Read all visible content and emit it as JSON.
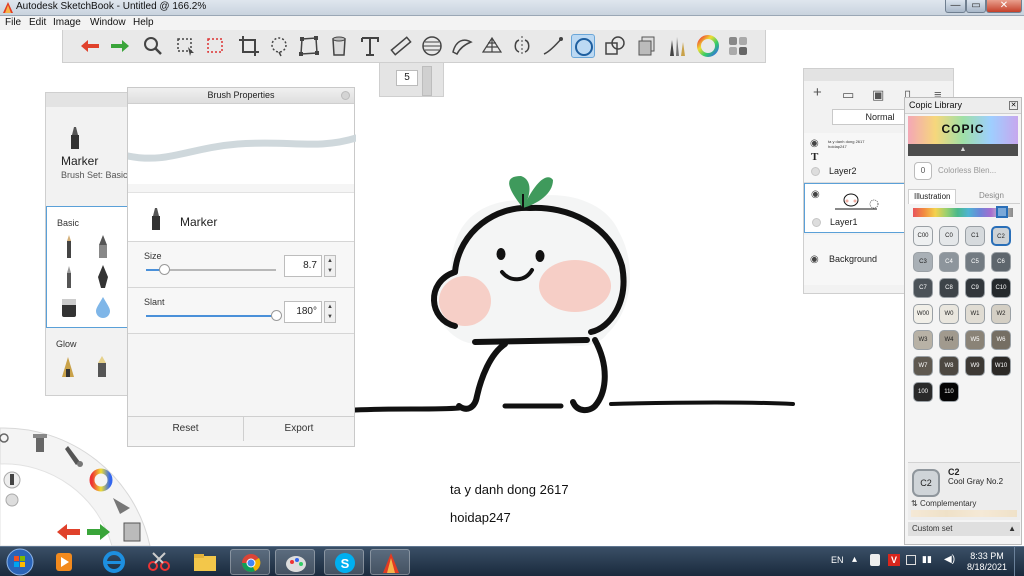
{
  "window": {
    "title": "Autodesk SketchBook - Untitled @ 166.2%",
    "min_label": "—",
    "max_label": "▭",
    "close_label": "✕"
  },
  "menu": {
    "items": [
      "File",
      "Edit",
      "Image",
      "Window",
      "Help"
    ]
  },
  "toolbar": {
    "tools": [
      "undo-icon",
      "redo-icon",
      "zoom-icon",
      "select-icon",
      "transform-select-icon",
      "crop-icon",
      "lasso-icon",
      "distort-icon",
      "fill-icon",
      "text-icon",
      "ruler-icon",
      "ellipse-guide-icon",
      "french-curve-icon",
      "perspective-icon",
      "symmetry-icon",
      "steady-stroke-icon",
      "predictive-stroke-icon",
      "shape-icon",
      "copy-icon",
      "brush-library-icon",
      "color-wheel-icon",
      "palette-grid-icon"
    ],
    "active_tool": "predictive-stroke-icon",
    "brush_size_value": "5"
  },
  "brush_library": {
    "brush_name": "Marker",
    "brush_set": "Brush Set: Basic",
    "section_basic": "Basic",
    "section_glow": "Glow"
  },
  "brush_properties": {
    "title": "Brush Properties",
    "brush_name": "Marker",
    "size_label": "Size",
    "size_value": "8.7",
    "size_fraction": 0.14,
    "slant_label": "Slant",
    "slant_value": "180°",
    "slant_fraction": 1.0,
    "reset_label": "Reset",
    "export_label": "Export"
  },
  "canvas": {
    "text_line1": "ta y danh dong 2617",
    "text_line2": "hoidap247"
  },
  "layers": {
    "blend_mode": "Normal",
    "items": [
      {
        "name": "Layer2",
        "thumb_line1": "ta y danh dong 2617",
        "thumb_line2": "hoidap247"
      },
      {
        "name": "Layer1"
      },
      {
        "name": "Background"
      }
    ]
  },
  "copic": {
    "title": "Copic Library",
    "logo": "COPIC",
    "colorless_code": "0",
    "colorless_name": "Colorless Blen...",
    "tab_illustration": "Illustration",
    "tab_design": "Design",
    "swatches": [
      {
        "code": "C00",
        "color": "#eef0f1"
      },
      {
        "code": "C0",
        "color": "#e4e7e9"
      },
      {
        "code": "C1",
        "color": "#d6dadd"
      },
      {
        "code": "C2",
        "color": "#cdd2d6"
      },
      {
        "code": "C3",
        "color": "#a9b0b6"
      },
      {
        "code": "C4",
        "color": "#8d959c"
      },
      {
        "code": "C5",
        "color": "#737b82"
      },
      {
        "code": "C6",
        "color": "#5e666d"
      },
      {
        "code": "C7",
        "color": "#4c5359"
      },
      {
        "code": "C8",
        "color": "#3e4449"
      },
      {
        "code": "C9",
        "color": "#32373b"
      },
      {
        "code": "C10",
        "color": "#25292c"
      },
      {
        "code": "W00",
        "color": "#f1efe8"
      },
      {
        "code": "W0",
        "color": "#e9e6de"
      },
      {
        "code": "W1",
        "color": "#e0dcd3"
      },
      {
        "code": "W2",
        "color": "#d4cfc4"
      },
      {
        "code": "W3",
        "color": "#b8b2a6"
      },
      {
        "code": "W4",
        "color": "#a19a8e"
      },
      {
        "code": "W5",
        "color": "#8a8377"
      },
      {
        "code": "W6",
        "color": "#756e63"
      },
      {
        "code": "W7",
        "color": "#5f5950"
      },
      {
        "code": "W8",
        "color": "#4d4841"
      },
      {
        "code": "W9",
        "color": "#3d3934"
      },
      {
        "code": "W10",
        "color": "#2c2926"
      },
      {
        "code": "100",
        "color": "#2a2a2a"
      },
      {
        "code": "110",
        "color": "#050505"
      }
    ],
    "selected_code": "C2",
    "selected_name": "Cool Gray No.2",
    "complementary_label": "Complementary",
    "custom_set_label": "Custom set"
  },
  "taskbar": {
    "apps": [
      "start-orb-icon",
      "media-player-icon",
      "internet-explorer-icon",
      "snipping-tool-icon",
      "file-explorer-icon",
      "chrome-icon",
      "paint-icon",
      "skype-icon",
      "sketchbook-icon"
    ],
    "language": "EN",
    "time": "8:33 PM",
    "date": "8/18/2021"
  }
}
